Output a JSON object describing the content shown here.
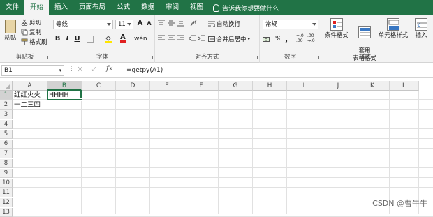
{
  "tabs": [
    "文件",
    "开始",
    "插入",
    "页面布局",
    "公式",
    "数据",
    "审阅",
    "视图"
  ],
  "active_tab": "开始",
  "tell_me": "告诉我你想要做什么",
  "ribbon": {
    "clipboard": {
      "label": "剪贴板",
      "paste": "粘贴",
      "cut": "剪切",
      "copy": "复制",
      "format_painter": "格式刷"
    },
    "font": {
      "label": "字体",
      "font_name": "等线",
      "font_size": "11",
      "bold": "B",
      "italic": "I",
      "underline": "U",
      "grow": "A",
      "shrink": "A",
      "font_color_glyph": "A"
    },
    "alignment": {
      "label": "对齐方式",
      "wrap": "自动换行",
      "merge": "合并后居中"
    },
    "number": {
      "label": "数字",
      "format": "常规",
      "percent": "%",
      "comma": ",",
      "inc_dec": "+.0 .00",
      "dec_dec": ".00 →.0"
    },
    "styles": {
      "label": "样式",
      "conditional": "条件格式",
      "table": "套用\n表格格式",
      "cell_styles": "单元格样式"
    },
    "cells": {
      "label": "",
      "insert": "插入"
    }
  },
  "formula_bar": {
    "name_box": "B1",
    "cancel": "✕",
    "enter": "✓",
    "fx": "fx",
    "formula": "=getpy(A1)"
  },
  "columns": [
    "A",
    "B",
    "C",
    "D",
    "E",
    "F",
    "G",
    "H",
    "I",
    "J",
    "K",
    "L"
  ],
  "rows": [
    "1",
    "2",
    "3",
    "4",
    "5",
    "6",
    "7",
    "8",
    "9",
    "10",
    "11",
    "12",
    "13"
  ],
  "cells": {
    "A1": "红红火火",
    "B1": "HHHH",
    "A2": "一二三四"
  },
  "selected_cell": "B1",
  "watermark": "CSDN @曹牛牛",
  "colors": {
    "brand": "#217346"
  }
}
